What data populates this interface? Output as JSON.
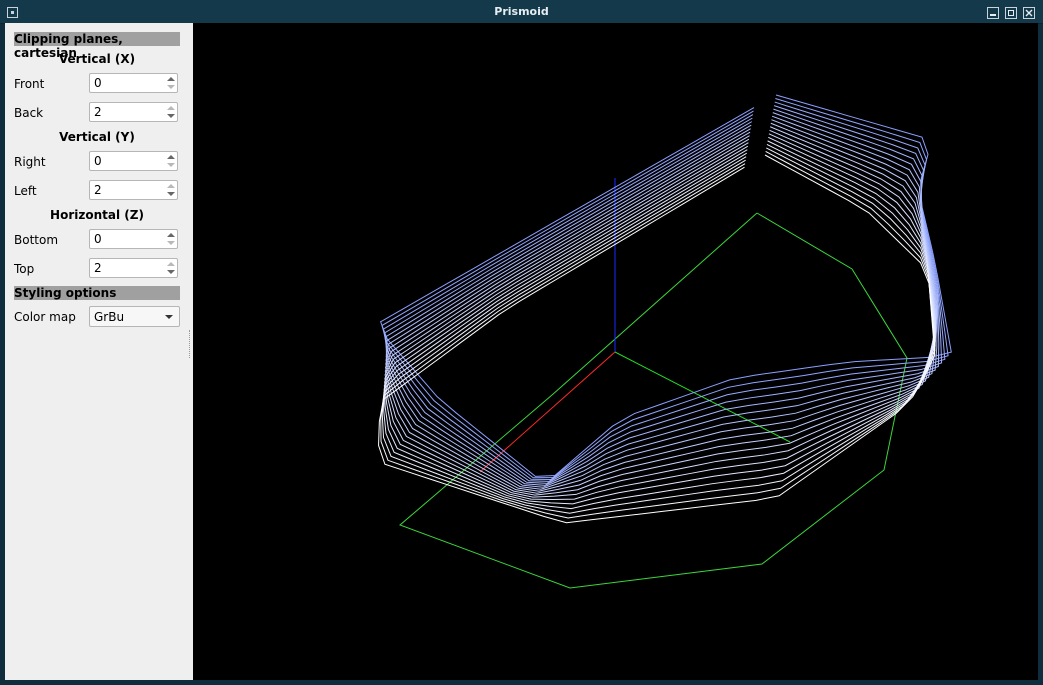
{
  "window": {
    "title": "Prismoid"
  },
  "panel": {
    "clipping_title": "Clipping planes, cartesian",
    "vertical_x": {
      "heading": "Vertical (X)",
      "front_label": "Front",
      "front_value": "0",
      "back_label": "Back",
      "back_value": "2"
    },
    "vertical_y": {
      "heading": "Vertical (Y)",
      "right_label": "Right",
      "right_value": "0",
      "left_label": "Left",
      "left_value": "2"
    },
    "horizontal_z": {
      "heading": "Horizontal (Z)",
      "bottom_label": "Bottom",
      "bottom_value": "0",
      "top_label": "Top",
      "top_value": "2"
    },
    "styling_title": "Styling options",
    "colormap_label": "Color map",
    "colormap_value": "GrBu"
  },
  "colors": {
    "axis_x": "#ff2a2a",
    "axis_y": "#22dd22",
    "axis_z": "#1a2cff",
    "ground": "#3bd63b",
    "stack_top": "#8aa0ff",
    "stack_bottom": "#ffffff"
  },
  "icons": {
    "window_menu": "window-menu-icon",
    "minimize": "minimize-icon",
    "maximize": "maximize-icon",
    "close": "close-icon"
  }
}
